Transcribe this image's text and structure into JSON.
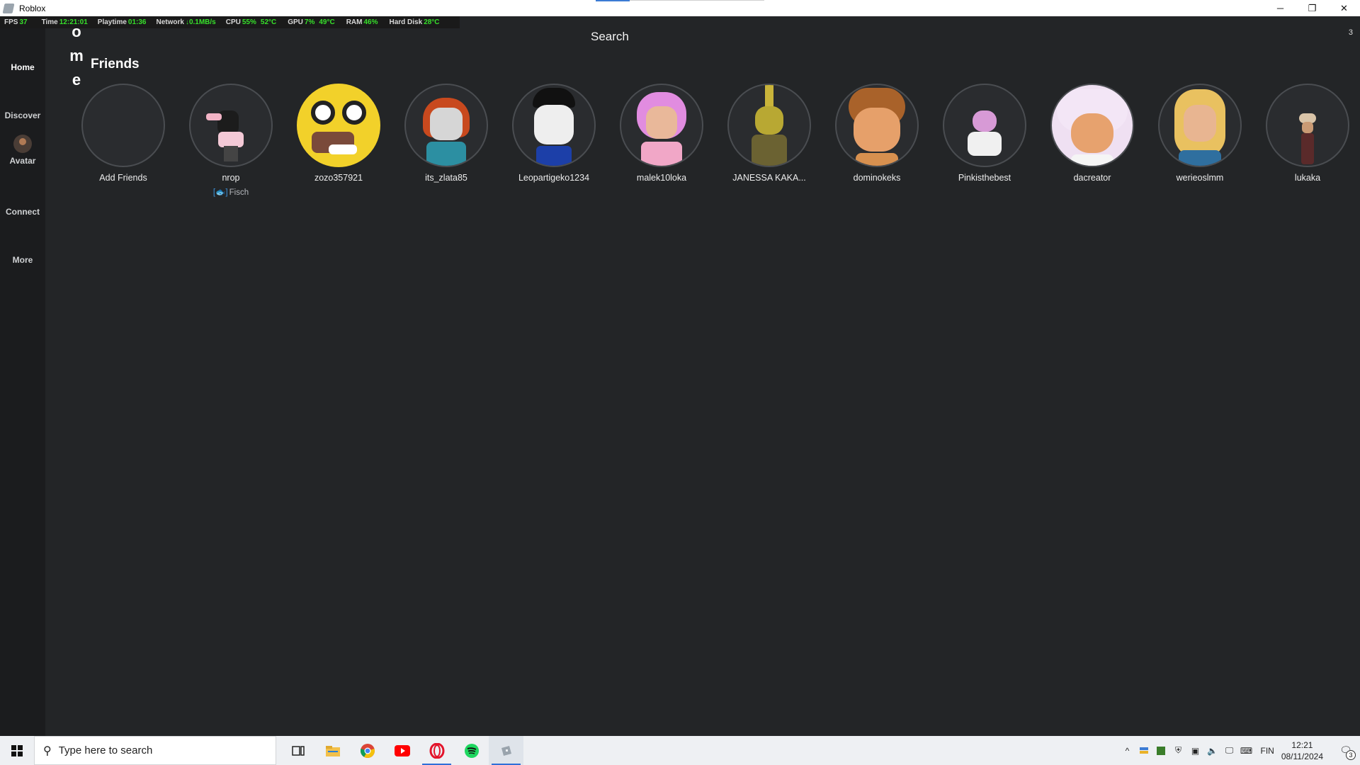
{
  "window": {
    "title": "Roblox",
    "controls": {
      "minimize": "─",
      "restore": "❐",
      "close": "✕"
    }
  },
  "stats": [
    {
      "label": "FPS",
      "value": "37"
    },
    {
      "label": "Time",
      "value": "12:21:01"
    },
    {
      "label": "Playtime",
      "value": "01:36"
    },
    {
      "label": "Network",
      "value": "↓0.1MB/s"
    },
    {
      "label": "CPU",
      "value": "55%",
      "value2": "52°C"
    },
    {
      "label": "GPU",
      "value": "7%",
      "value2": "49°C"
    },
    {
      "label": "RAM",
      "value": "46%"
    },
    {
      "label": "Hard Disk",
      "value": "28°C"
    }
  ],
  "sidebar": {
    "items": [
      {
        "label": "Home"
      },
      {
        "label": "Discover"
      },
      {
        "label": "Avatar"
      },
      {
        "label": "Connect"
      },
      {
        "label": "More"
      }
    ]
  },
  "header": {
    "search_label": "Search",
    "corner_count": "3",
    "home_letters": [
      "o",
      "m",
      "e"
    ]
  },
  "friends_section": {
    "title": "Friends"
  },
  "friends": [
    {
      "name": "Add Friends",
      "status": ""
    },
    {
      "name": "nrop",
      "status": "Fisch",
      "status_icon": "[🐟]"
    },
    {
      "name": "zozo357921",
      "status": ""
    },
    {
      "name": "its_zlata85",
      "status": ""
    },
    {
      "name": "Leopartigeko1234",
      "status": ""
    },
    {
      "name": "malek10loka",
      "status": ""
    },
    {
      "name": "JANESSA KAKA...",
      "status": ""
    },
    {
      "name": "dominokeks",
      "status": ""
    },
    {
      "name": "Pinkisthebest",
      "status": ""
    },
    {
      "name": "dacreator",
      "status": ""
    },
    {
      "name": "werieoslmm",
      "status": ""
    },
    {
      "name": "lukaka",
      "status": ""
    }
  ],
  "taskbar": {
    "search_placeholder": "Type here to search",
    "language": "FIN",
    "time": "12:21",
    "date": "08/11/2024",
    "notification_count": "3"
  }
}
